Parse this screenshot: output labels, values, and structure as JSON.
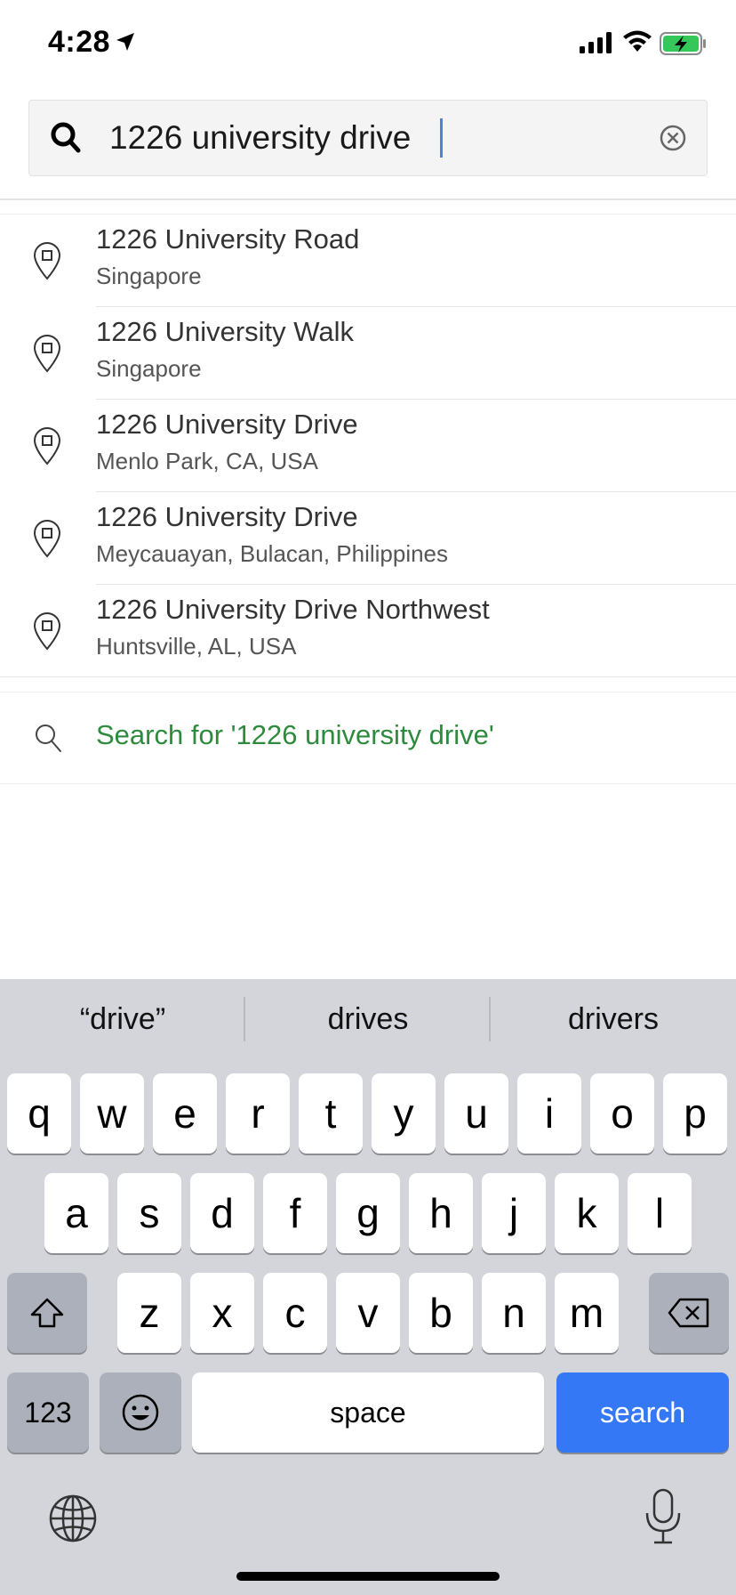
{
  "status_bar": {
    "time": "4:28",
    "icons": [
      "location-arrow-icon",
      "cellular-signal-icon",
      "wifi-icon",
      "battery-charging-icon"
    ]
  },
  "search": {
    "value": "1226 university drive",
    "icon": "search-icon",
    "clear_icon": "clear-circle-icon"
  },
  "results": [
    {
      "title": "1226 University Road",
      "subtitle": "Singapore"
    },
    {
      "title": "1226 University Walk",
      "subtitle": "Singapore"
    },
    {
      "title": "1226 University Drive",
      "subtitle": "Menlo Park, CA, USA"
    },
    {
      "title": "1226 University Drive",
      "subtitle": "Meycauayan, Bulacan, Philippines"
    },
    {
      "title": "1226 University Drive Northwest",
      "subtitle": "Huntsville, AL, USA"
    }
  ],
  "search_for": {
    "label": "Search for '1226 university drive'",
    "color": "#2e8b3e"
  },
  "keyboard": {
    "suggestions": [
      "“drive”",
      "drives",
      "drivers"
    ],
    "row1": [
      "q",
      "w",
      "e",
      "r",
      "t",
      "y",
      "u",
      "i",
      "o",
      "p"
    ],
    "row2": [
      "a",
      "s",
      "d",
      "f",
      "g",
      "h",
      "j",
      "k",
      "l"
    ],
    "row3": [
      "z",
      "x",
      "c",
      "v",
      "b",
      "n",
      "m"
    ],
    "numbers_label": "123",
    "space_label": "space",
    "search_label": "search",
    "search_color": "#3478f6"
  }
}
